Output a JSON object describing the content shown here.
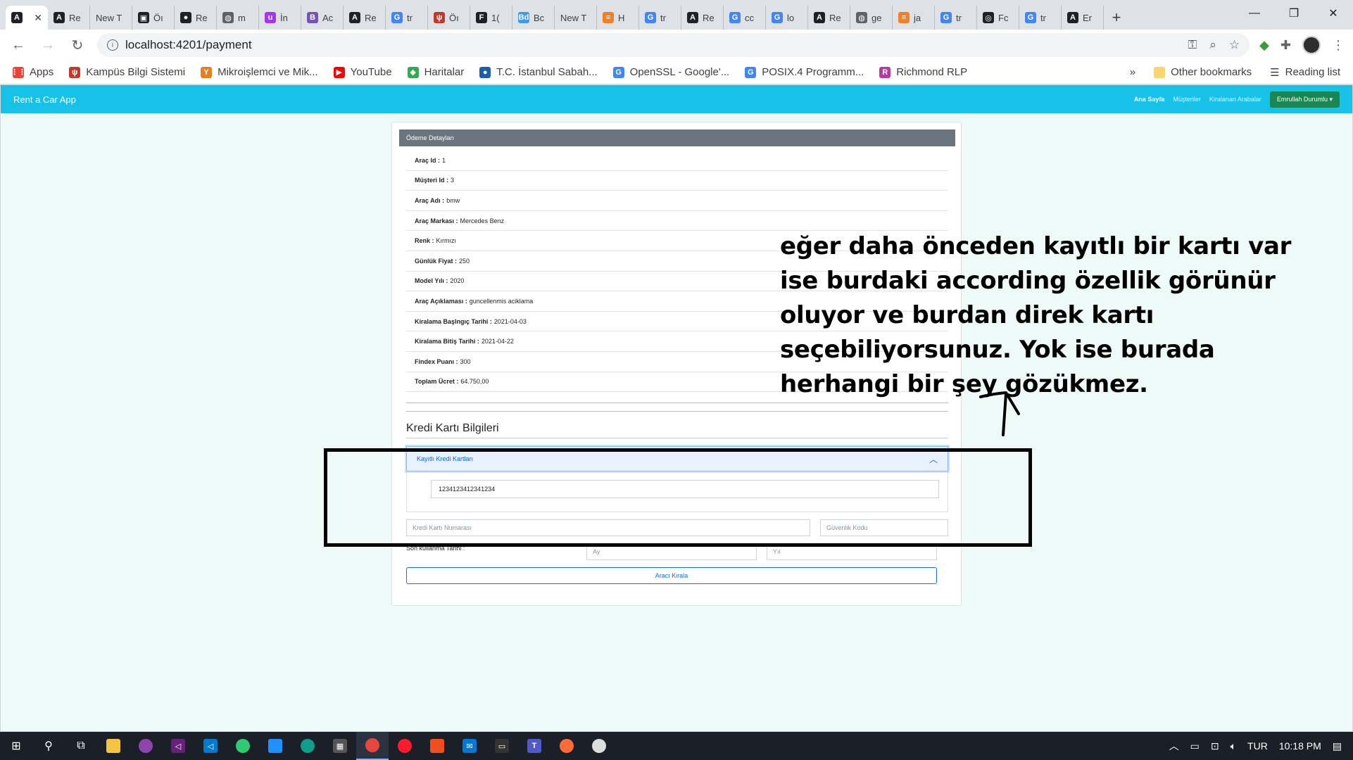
{
  "browser": {
    "tabs": [
      {
        "label": "",
        "icon": "angular-icon",
        "color": "#202124",
        "glyph": "A",
        "active": true
      },
      {
        "label": "Re",
        "icon": "angular-icon",
        "color": "#202124",
        "glyph": "A"
      },
      {
        "label": "New T",
        "icon": "",
        "color": "",
        "glyph": ""
      },
      {
        "label": "Öı",
        "icon": "scan-icon",
        "color": "#202124",
        "glyph": "▣"
      },
      {
        "label": "Re",
        "icon": "github-icon",
        "color": "#202124",
        "glyph": "●"
      },
      {
        "label": "m",
        "icon": "globe-icon",
        "color": "#5f6368",
        "glyph": "◍"
      },
      {
        "label": "İn",
        "icon": "udemy-icon",
        "color": "#a435f0",
        "glyph": "u"
      },
      {
        "label": "Ac",
        "icon": "bootstrap-icon",
        "color": "#7952b3",
        "glyph": "B"
      },
      {
        "label": "Re",
        "icon": "angular-icon",
        "color": "#202124",
        "glyph": "A"
      },
      {
        "label": "tr",
        "icon": "google-icon",
        "color": "#4285f4",
        "glyph": "G"
      },
      {
        "label": "Öı",
        "icon": "campus-icon",
        "color": "#c0392b",
        "glyph": "ψ"
      },
      {
        "label": "1(",
        "icon": "f-icon",
        "color": "#202124",
        "glyph": "F"
      },
      {
        "label": "Bc",
        "icon": "bd-icon",
        "color": "#3d9be9",
        "glyph": "Bd"
      },
      {
        "label": "New T",
        "icon": "",
        "color": "",
        "glyph": ""
      },
      {
        "label": "H",
        "icon": "stackoverflow-icon",
        "color": "#f48024",
        "glyph": "≡"
      },
      {
        "label": "tr",
        "icon": "google-icon",
        "color": "#4285f4",
        "glyph": "G"
      },
      {
        "label": "Re",
        "icon": "angular-icon",
        "color": "#202124",
        "glyph": "A"
      },
      {
        "label": "cc",
        "icon": "google-icon",
        "color": "#4285f4",
        "glyph": "G"
      },
      {
        "label": "lo",
        "icon": "google-icon",
        "color": "#4285f4",
        "glyph": "G"
      },
      {
        "label": "Re",
        "icon": "angular-icon",
        "color": "#202124",
        "glyph": "A"
      },
      {
        "label": "ge",
        "icon": "globe-icon",
        "color": "#5f6368",
        "glyph": "◍"
      },
      {
        "label": "ja",
        "icon": "stackoverflow-icon",
        "color": "#f48024",
        "glyph": "≡"
      },
      {
        "label": "tr",
        "icon": "google-icon",
        "color": "#4285f4",
        "glyph": "G"
      },
      {
        "label": "Fc",
        "icon": "openai-icon",
        "color": "#202124",
        "glyph": "◎"
      },
      {
        "label": "tr",
        "icon": "google-icon",
        "color": "#4285f4",
        "glyph": "G"
      },
      {
        "label": "Er",
        "icon": "angular-icon",
        "color": "#202124",
        "glyph": "A"
      }
    ],
    "url": "localhost:4201/payment",
    "bookmarks": [
      {
        "label": "Apps",
        "icon": "apps-grid-icon",
        "color": "#ea4335",
        "glyph": "⋮⋮"
      },
      {
        "label": "Kampüs Bilgi Sistemi",
        "icon": "campus-icon",
        "color": "#c0392b",
        "glyph": "ψ"
      },
      {
        "label": "Mikroişlemci ve Mik...",
        "icon": "ytu-icon",
        "color": "#e67e22",
        "glyph": "Y"
      },
      {
        "label": "YouTube",
        "icon": "youtube-icon",
        "color": "#ff0000",
        "glyph": "▶"
      },
      {
        "label": "Haritalar",
        "icon": "maps-icon",
        "color": "#34a853",
        "glyph": "◆"
      },
      {
        "label": "T.C. İstanbul Sabah...",
        "icon": "university-icon",
        "color": "#1a5ea8",
        "glyph": "●"
      },
      {
        "label": "OpenSSL - Google'...",
        "icon": "google-icon",
        "color": "#4285f4",
        "glyph": "G"
      },
      {
        "label": "POSIX.4 Programm...",
        "icon": "google-icon",
        "color": "#4285f4",
        "glyph": "G"
      },
      {
        "label": "Richmond RLP",
        "icon": "richmond-icon",
        "color": "#b33aa0",
        "glyph": "R"
      }
    ],
    "more": "»",
    "other_bookmarks": "Other bookmarks",
    "reading_list": "Reading list"
  },
  "app": {
    "brand": "Rent a Car App",
    "nav": {
      "home": "Ana Sayfa",
      "customers": "Müşteriler",
      "rented": "Kiralanan Arabalar",
      "user": "Emrullah Durumlu"
    },
    "card_header": "Ödeme Detayları",
    "details": [
      {
        "label": "Araç Id :",
        "value": "1"
      },
      {
        "label": "Müşteri Id :",
        "value": "3"
      },
      {
        "label": "Araç Adı :",
        "value": "bmw"
      },
      {
        "label": "Araç Markası :",
        "value": "Mercedes Benz"
      },
      {
        "label": "Renk :",
        "value": "Kırmızı"
      },
      {
        "label": "Günlük Fiyat :",
        "value": "250"
      },
      {
        "label": "Model Yılı :",
        "value": "2020"
      },
      {
        "label": "Araç Açıklaması :",
        "value": "guncellenmis aciklama"
      },
      {
        "label": "Kiralama Başlngıç Tarihi :",
        "value": "2021-04-03"
      },
      {
        "label": "Kiralama Bitiş Tarihi :",
        "value": "2021-04-22"
      },
      {
        "label": "Findex Puanı :",
        "value": "300"
      },
      {
        "label": "Toplam Ücret :",
        "value": "64.750,00"
      }
    ],
    "cc_title": "Kredi Kartı Bilgileri",
    "accordion_label": "Kayıtlı Kredi Kartları",
    "saved_card": "1234123412341234",
    "card_number_placeholder": "Kredi Kartı Numarası",
    "security_code_placeholder": "Güvenlik Kodu",
    "expiry_label": "Son kullanma Tarihi :",
    "month_placeholder": "Ay",
    "year_placeholder": "Yıl",
    "rent_button": "Aracı Kirala"
  },
  "annotation": {
    "text": "eğer daha önceden kayıtlı bir kartı var ise burdaki according özellik görünür oluyor ve burdan direk kartı seçebiliyorsunuz. Yok ise burada herhangi bir şey gözükmez."
  },
  "taskbar": {
    "language": "TUR",
    "time": "10:18 PM"
  },
  "colors": {
    "navbar": "#17c1e8",
    "page_bg": "#eefaf8",
    "card_header": "#6c757d",
    "user_button": "#198754",
    "primary": "#0d6efd"
  }
}
